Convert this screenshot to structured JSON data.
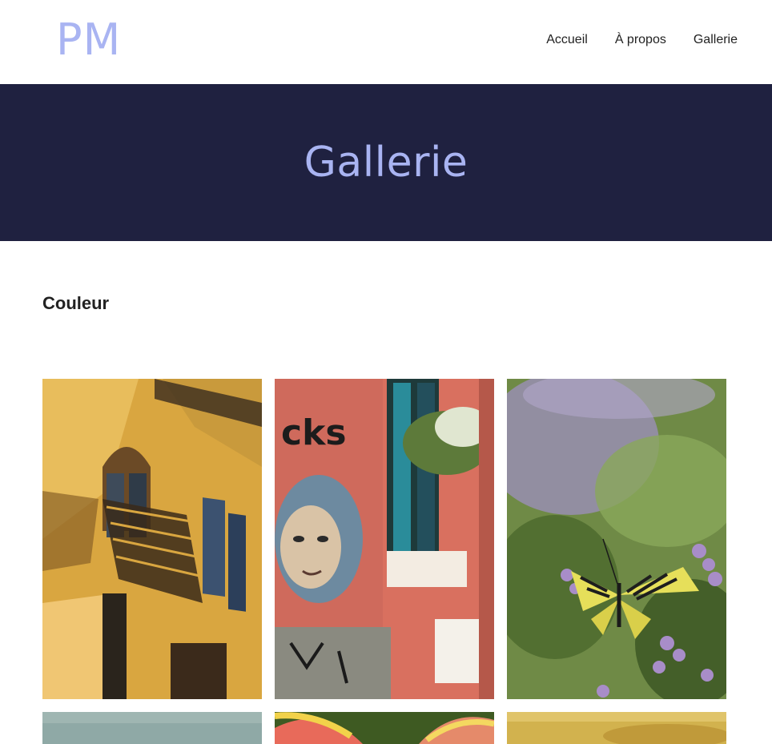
{
  "site": {
    "logo": "PM"
  },
  "nav": {
    "items": [
      "Accueil",
      "À propos",
      "Gallerie"
    ]
  },
  "hero": {
    "title": "Gallerie"
  },
  "section": {
    "title": "Couleur"
  },
  "gallery": {
    "photos": [
      "venice-balcony-photo",
      "graffiti-wall-photo",
      "butterfly-lavender-photo",
      "sky-photo",
      "flower-petals-photo",
      "golden-field-photo"
    ]
  },
  "colors": {
    "accent": "#a9b4f2",
    "hero_bg": "#1f2140",
    "text": "#222222"
  }
}
